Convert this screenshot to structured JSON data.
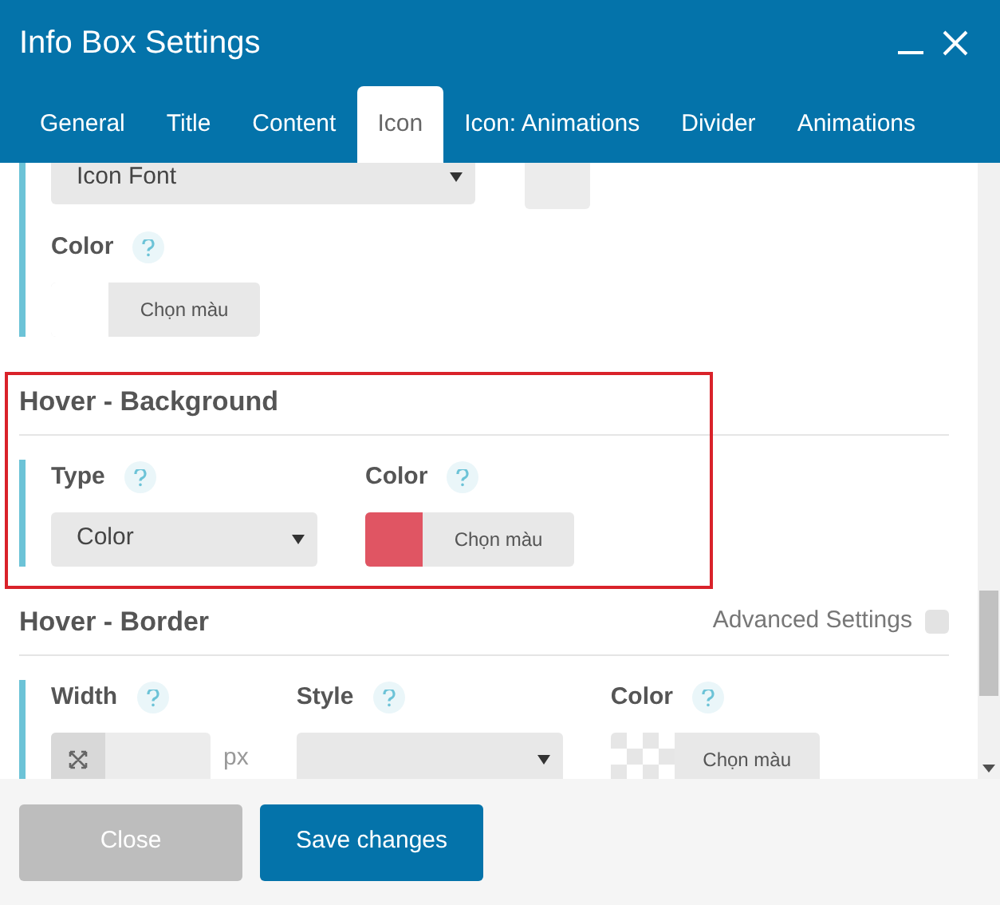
{
  "window": {
    "title": "Info Box Settings"
  },
  "tabs": [
    {
      "label": "General",
      "selected": false
    },
    {
      "label": "Title",
      "selected": false
    },
    {
      "label": "Content",
      "selected": false
    },
    {
      "label": "Icon",
      "selected": true
    },
    {
      "label": "Icon: Animations",
      "selected": false
    },
    {
      "label": "Divider",
      "selected": false
    },
    {
      "label": "Animations",
      "selected": false
    }
  ],
  "top_section": {
    "select_value": "Icon Font",
    "color_label": "Color",
    "color_button": "Chọn màu",
    "color": "#ffffff"
  },
  "sections": [
    {
      "title": "Hover - Background",
      "highlighted": true,
      "fields": [
        {
          "kind": "select",
          "label": "Type",
          "value": "Color"
        },
        {
          "kind": "color",
          "label": "Color",
          "button": "Chọn màu",
          "color": "#e05563"
        }
      ]
    },
    {
      "title": "Hover - Border",
      "highlighted": false,
      "advanced": {
        "label": "Advanced Settings",
        "checked": false
      },
      "fields": [
        {
          "kind": "number",
          "label": "Width",
          "unit": "px"
        },
        {
          "kind": "select",
          "label": "Style"
        },
        {
          "kind": "transparent_color",
          "label": "Color",
          "button": "Chọn màu"
        }
      ]
    }
  ],
  "buttons": [
    {
      "kind": "secondary",
      "label": "Close"
    },
    {
      "kind": "primary",
      "label": "Save changes"
    }
  ]
}
